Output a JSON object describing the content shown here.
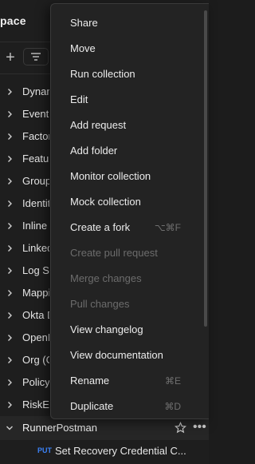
{
  "workspace": {
    "title": "pace"
  },
  "toolbar": {
    "add_label": "+"
  },
  "tree": {
    "items": [
      {
        "label": "Dynam"
      },
      {
        "label": "Event"
      },
      {
        "label": "Factor"
      },
      {
        "label": "Featur"
      },
      {
        "label": "Group"
      },
      {
        "label": "Identit"
      },
      {
        "label": "Inline"
      },
      {
        "label": "Linked"
      },
      {
        "label": "Log St"
      },
      {
        "label": "Mappi"
      },
      {
        "label": "Okta D"
      },
      {
        "label": "OpenI"
      },
      {
        "label": "Org (C"
      },
      {
        "label": "Policy"
      },
      {
        "label": "RiskEv"
      }
    ],
    "expanded": {
      "label": "RunnerPostman"
    },
    "request": {
      "method": "PUT",
      "label": "Set Recovery Credential C..."
    }
  },
  "menu": {
    "items": [
      {
        "label": "Share",
        "shortcut": "",
        "disabled": false
      },
      {
        "label": "Move",
        "shortcut": "",
        "disabled": false
      },
      {
        "label": "Run collection",
        "shortcut": "",
        "disabled": false
      },
      {
        "label": "Edit",
        "shortcut": "",
        "disabled": false
      },
      {
        "label": "Add request",
        "shortcut": "",
        "disabled": false
      },
      {
        "label": "Add folder",
        "shortcut": "",
        "disabled": false
      },
      {
        "label": "Monitor collection",
        "shortcut": "",
        "disabled": false
      },
      {
        "label": "Mock collection",
        "shortcut": "",
        "disabled": false
      },
      {
        "label": "Create a fork",
        "shortcut": "⌥⌘F",
        "disabled": false
      },
      {
        "label": "Create pull request",
        "shortcut": "",
        "disabled": true
      },
      {
        "label": "Merge changes",
        "shortcut": "",
        "disabled": true
      },
      {
        "label": "Pull changes",
        "shortcut": "",
        "disabled": true
      },
      {
        "label": "View changelog",
        "shortcut": "",
        "disabled": false
      },
      {
        "label": "View documentation",
        "shortcut": "",
        "disabled": false
      },
      {
        "label": "Rename",
        "shortcut": "⌘E",
        "disabled": false
      },
      {
        "label": "Duplicate",
        "shortcut": "⌘D",
        "disabled": false
      }
    ]
  },
  "colors": {
    "method_put": "#3b82f6",
    "menu_bg": "#232323",
    "sidebar_bg": "#1e1e1e"
  }
}
